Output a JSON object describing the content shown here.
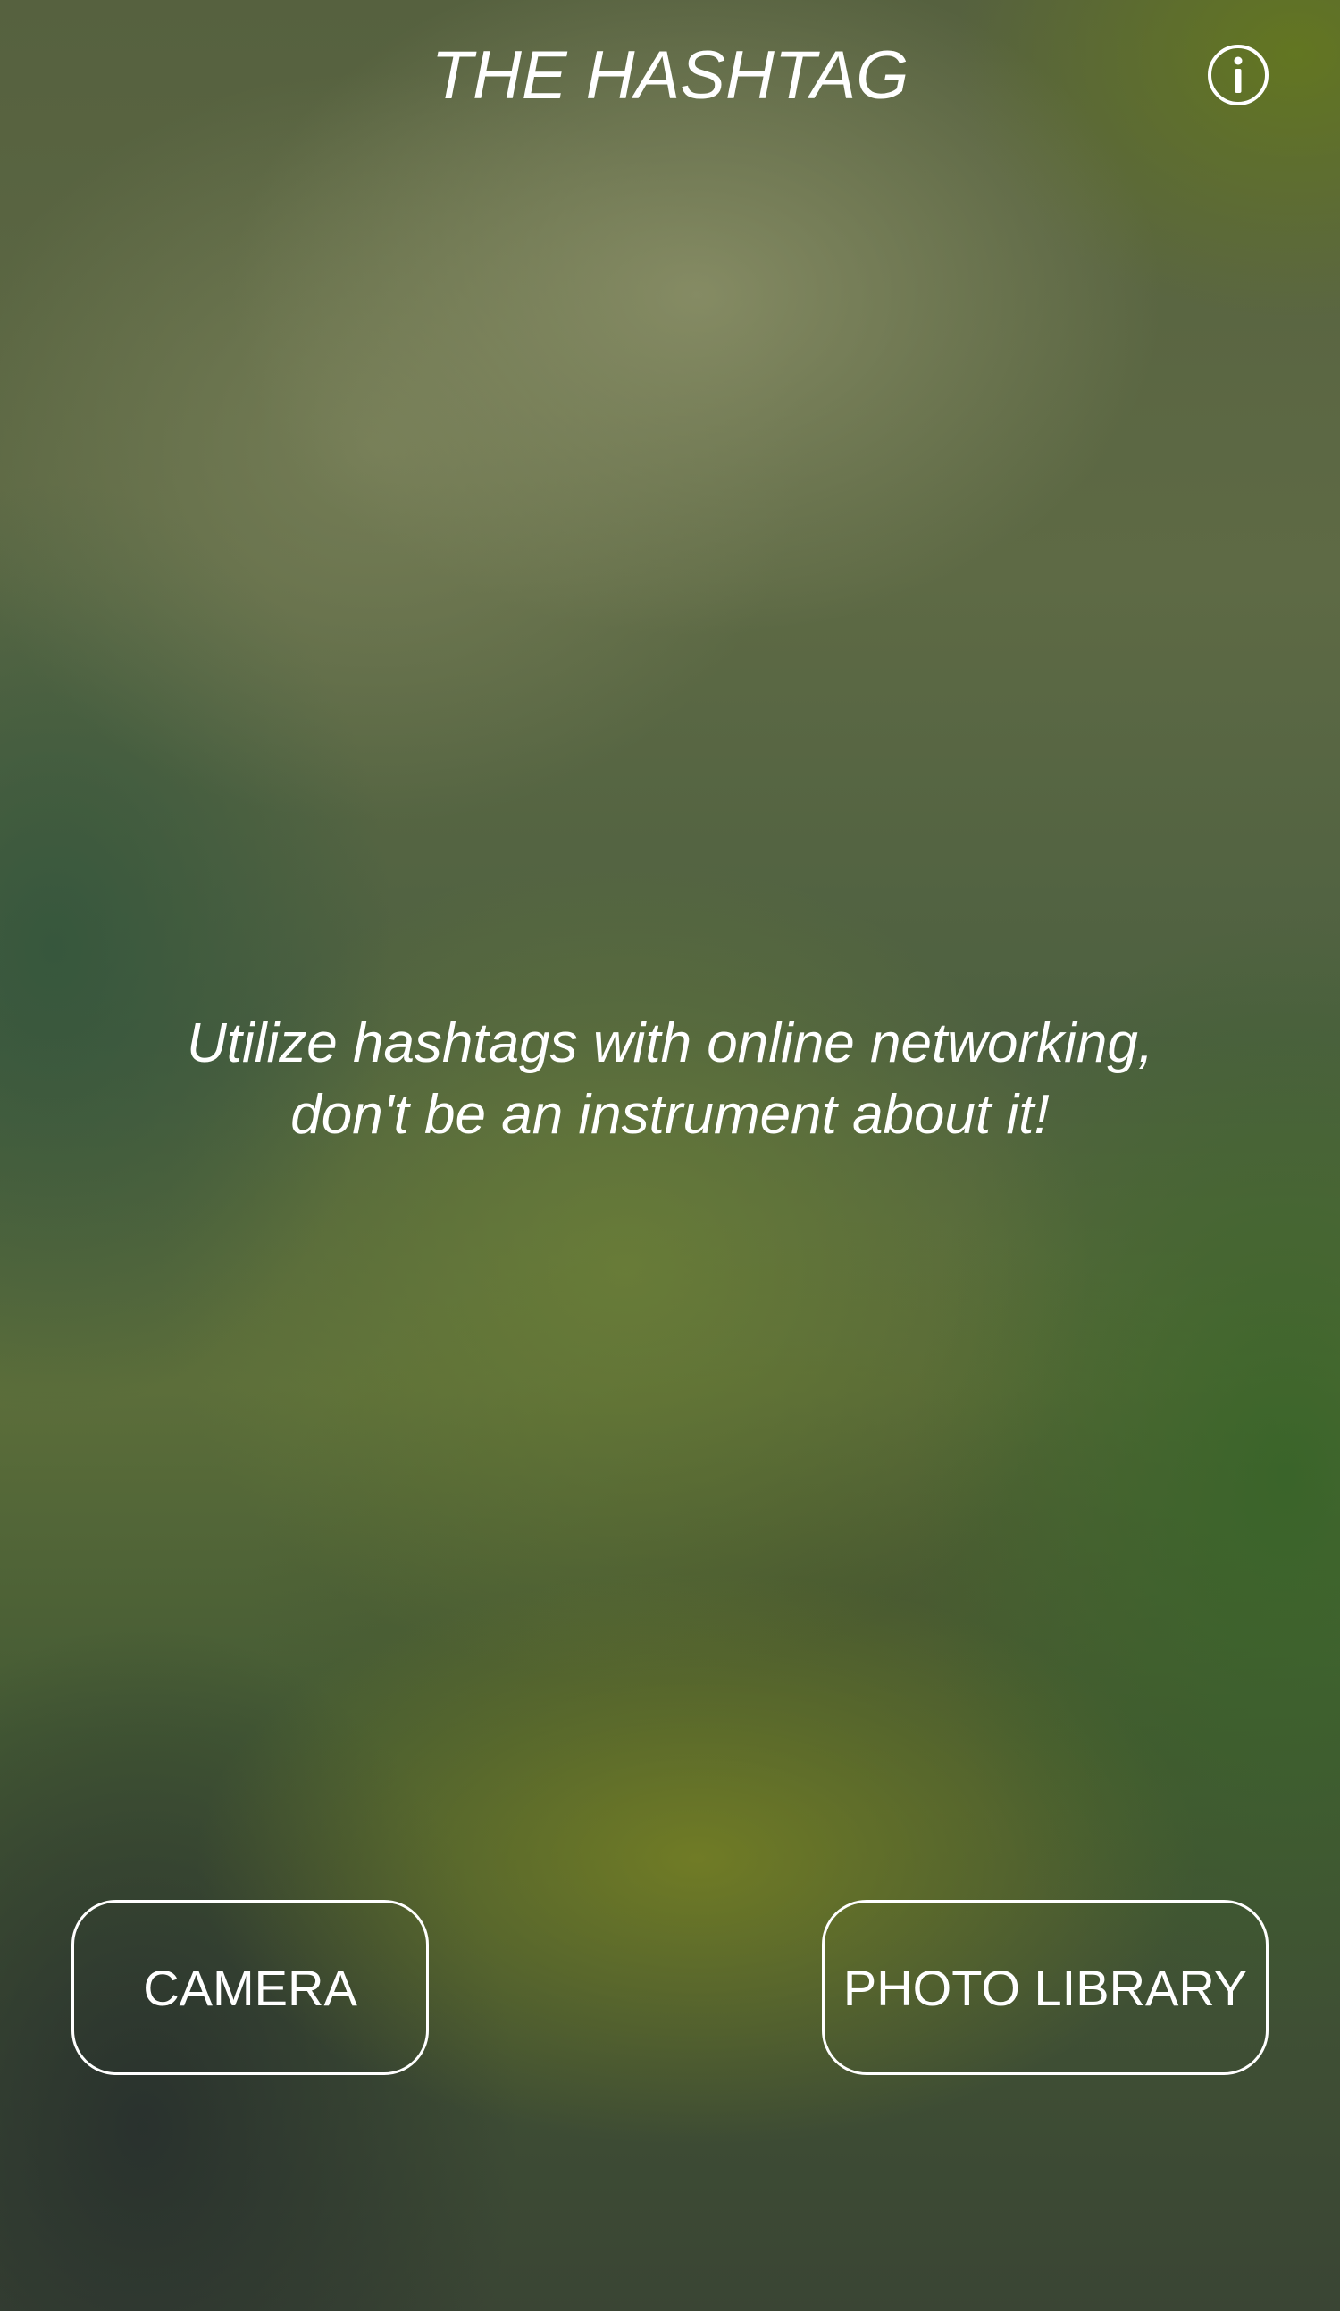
{
  "header": {
    "title": "THE HASHTAG",
    "info_icon": "info-circle-icon"
  },
  "main": {
    "tagline": "Utilize hashtags with online networking, don't be an instrument about it!"
  },
  "actions": {
    "camera_label": "CAMERA",
    "photo_library_label": "PHOTO LIBRARY"
  },
  "colors": {
    "text": "#ffffff",
    "button_border": "#ffffff"
  }
}
